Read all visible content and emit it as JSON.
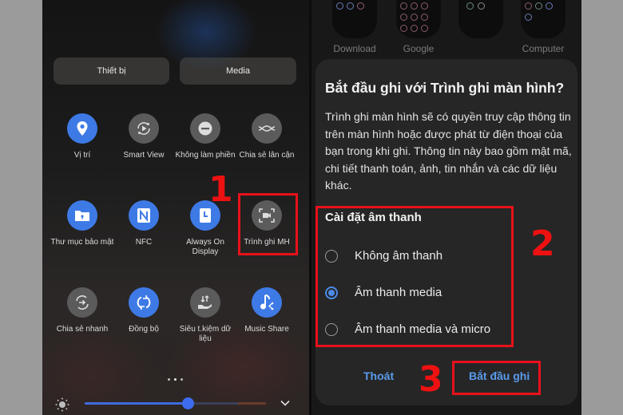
{
  "left_screen": {
    "segments": [
      "Thiết bị",
      "Media"
    ],
    "tiles": [
      {
        "label": "Vị trí",
        "icon": "location-pin-icon",
        "state": "on"
      },
      {
        "label": "Smart View",
        "icon": "smart-view-icon",
        "state": "off"
      },
      {
        "label": "Không làm phiền",
        "icon": "do-not-disturb-icon",
        "state": "off"
      },
      {
        "label": "Chia sẻ lân cận",
        "icon": "nearby-share-icon",
        "state": "off"
      },
      {
        "label": "Thư mục bảo mật",
        "icon": "secure-folder-icon",
        "state": "on"
      },
      {
        "label": "NFC",
        "icon": "nfc-icon",
        "state": "on"
      },
      {
        "label": "Always On Display",
        "icon": "always-on-display-icon",
        "state": "on"
      },
      {
        "label": "Trình ghi MH",
        "icon": "screen-recorder-icon",
        "state": "off"
      },
      {
        "label": "Chia sẻ nhanh",
        "icon": "quick-share-icon",
        "state": "off"
      },
      {
        "label": "Đồng bộ",
        "icon": "sync-icon",
        "state": "on"
      },
      {
        "label": "Siêu t.kiệm dữ liệu",
        "icon": "data-saver-icon",
        "state": "off"
      },
      {
        "label": "Music Share",
        "icon": "music-share-icon",
        "state": "on"
      }
    ],
    "page_indicator": {
      "pages": 3,
      "active": 2
    },
    "brightness": {
      "value_percent": 57,
      "icon": "sun-icon"
    },
    "expand_icon": "chevron-down-icon"
  },
  "right_screen": {
    "folders": [
      "Download",
      "Google",
      "",
      "Computer"
    ],
    "dialog": {
      "title": "Bắt đầu ghi với Trình ghi màn hình?",
      "body": "Trình ghi màn hình sẽ có quyền truy cập thông tin trên màn hình hoặc được phát từ điện thoại của bạn trong khi ghi. Thông tin này bao gồm mật mã, chi tiết thanh toán, ảnh, tin nhắn và các dữ liệu khác.",
      "sound_settings": {
        "heading": "Cài đặt âm thanh",
        "options": [
          {
            "label": "Không âm thanh",
            "selected": false
          },
          {
            "label": "Âm thanh media",
            "selected": true
          },
          {
            "label": "Âm thanh media và micro",
            "selected": false
          }
        ]
      },
      "cancel_label": "Thoát",
      "start_label": "Bắt đầu ghi"
    }
  },
  "annotations": {
    "step1": "1",
    "step2": "2",
    "step3": "3",
    "highlight_color": "#e8111a"
  },
  "colors": {
    "accent_blue": "#3e7ae6",
    "dialog_button": "#5a9bec"
  }
}
